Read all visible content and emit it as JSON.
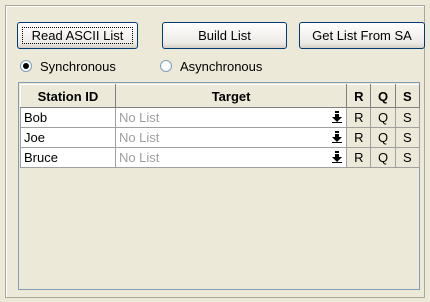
{
  "toolbar": {
    "read_ascii_label": "Read ASCII List",
    "build_list_label": "Build List",
    "get_list_sa_label": "Get List From SA"
  },
  "mode": {
    "options": [
      "Synchronous",
      "Asynchronous"
    ],
    "selected": "Synchronous"
  },
  "grid": {
    "headers": {
      "station_id": "Station ID",
      "target": "Target",
      "r": "R",
      "q": "Q",
      "s": "S"
    },
    "rows": [
      {
        "station": "Bob",
        "target": "No List",
        "r": "R",
        "q": "Q",
        "s": "S"
      },
      {
        "station": "Joe",
        "target": "No List",
        "r": "R",
        "q": "Q",
        "s": "S"
      },
      {
        "station": "Bruce",
        "target": "No List",
        "r": "R",
        "q": "Q",
        "s": "S"
      }
    ]
  },
  "icons": {
    "target_dropdown": "down-arrow-icon"
  }
}
